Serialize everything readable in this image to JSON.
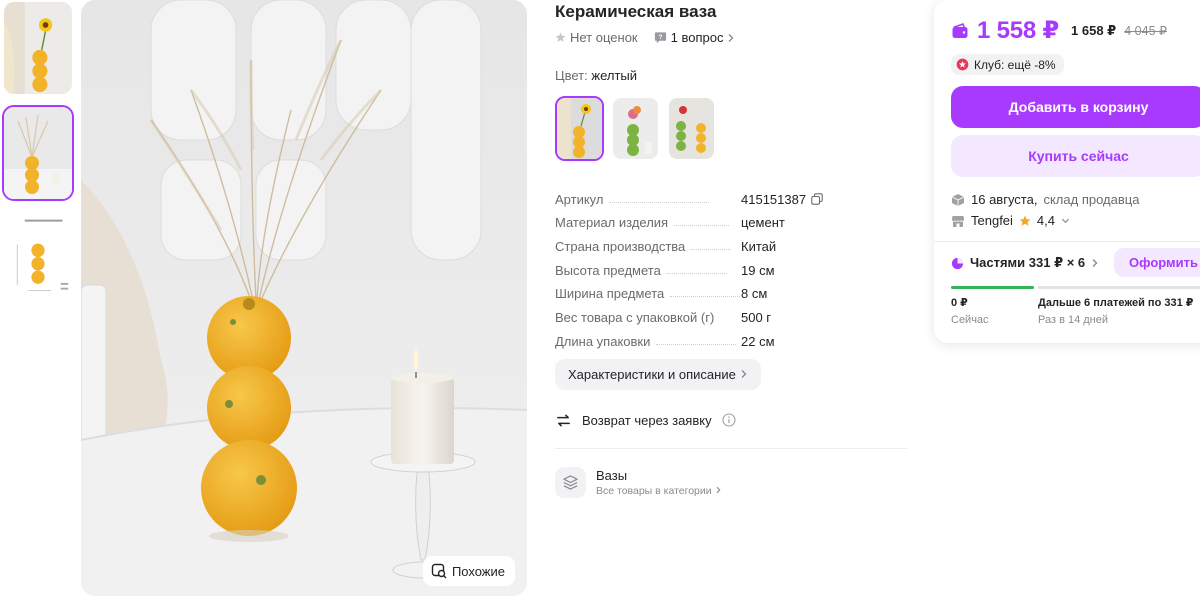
{
  "product": {
    "title": "Керамическая ваза",
    "rating_text": "Нет оценок",
    "questions_text": "1 вопрос",
    "color_label": "Цвет:",
    "color_value": "желтый",
    "specs": [
      {
        "name": "Артикул",
        "value": "415151387"
      },
      {
        "name": "Материал изделия",
        "value": "цемент"
      },
      {
        "name": "Страна производства",
        "value": "Китай"
      },
      {
        "name": "Высота предмета",
        "value": "19 см"
      },
      {
        "name": "Ширина предмета",
        "value": "8 см"
      },
      {
        "name": "Вес товара с упаковкой (г)",
        "value": "500 г"
      },
      {
        "name": "Длина упаковки",
        "value": "22 см"
      }
    ],
    "chars_button": "Характеристики и описание",
    "return_text": "Возврат через заявку",
    "category_title": "Вазы",
    "category_sub": "Все товары в категории",
    "similar_button": "Похожие"
  },
  "buy_panel": {
    "price": "1 558 ₽",
    "price_old1": "1 658 ₽",
    "price_old2": "4 045 ₽",
    "club_text": "Клуб: ещё -8%",
    "add_to_cart": "Добавить в корзину",
    "buy_now": "Купить сейчас",
    "delivery_date": "16 августа,",
    "delivery_source": "склад продавца",
    "seller_name": "Tengfei",
    "seller_rating": "4,4",
    "installments": "Частями 331 ₽ × 6",
    "installments_button": "Оформить",
    "pay_now_value": "0 ₽",
    "pay_now_label": "Сейчас",
    "pay_next_value": "Дальше 6 платежей по 331 ₽",
    "pay_next_label": "Раз в 14 дней"
  },
  "colors": {
    "accent": "#a73afd",
    "accent_light": "#f3e8ff",
    "green": "#2fb45a",
    "vase": "#f2b32b"
  },
  "icons": [
    "star-icon",
    "question-icon",
    "copy-icon",
    "return-icon",
    "info-icon",
    "category-icon",
    "wallet-icon",
    "club-icon",
    "box-icon",
    "shop-icon",
    "installments-icon",
    "similar-icon",
    "chevron-right-icon",
    "chevron-down-icon"
  ]
}
